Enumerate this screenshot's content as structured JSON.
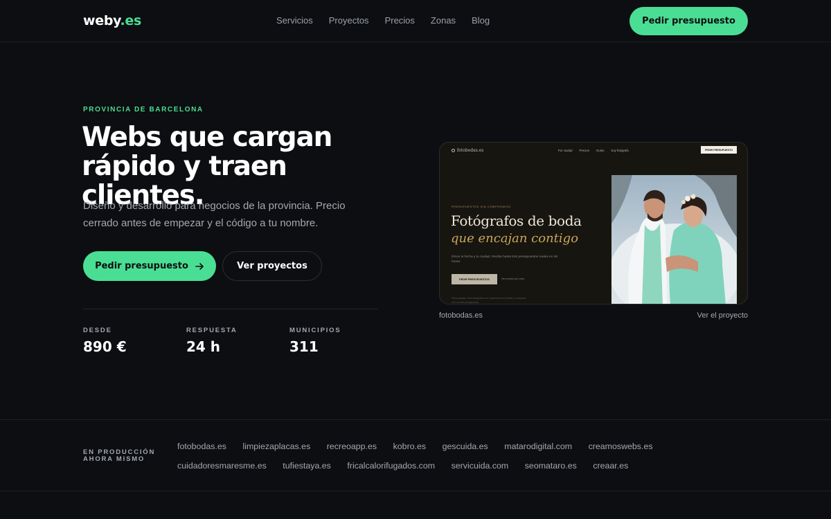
{
  "header": {
    "logo_name": "weby",
    "logo_tld": ".es",
    "nav": [
      "Servicios",
      "Proyectos",
      "Precios",
      "Zonas",
      "Blog"
    ],
    "cta_label": "Pedir presupuesto"
  },
  "hero": {
    "eyebrow": "PROVINCIA DE BARCELONA",
    "headline_line1": "Webs que cargan",
    "headline_line2": "rápido y traen clientes.",
    "lead_line1": "Diseño y desarrollo para negocios de la provincia. Precio",
    "lead_line2": "cerrado antes de empezar y el código a tu nombre.",
    "primary_button": "Pedir presupuesto",
    "secondary_button": "Ver proyectos",
    "stats": [
      {
        "label": "DESDE",
        "value": "890 €"
      },
      {
        "label": "RESPUESTA",
        "value": "24 h"
      },
      {
        "label": "MUNICIPIOS",
        "value": "311"
      }
    ]
  },
  "preview": {
    "site_logo": "fotobodas.es",
    "site_nav": [
      "Por ciudad",
      "Precios",
      "Guías",
      "Soy fotógrafo"
    ],
    "site_cta": "PEDIR PRESUPUESTO",
    "site_eyebrow": "PRESUPUESTOS SIN COMPROMISO",
    "site_title_line1": "Fotógrafos de boda",
    "site_title_line2": "que encajan contigo",
    "site_subtitle": "Dinos tu fecha y tu ciudad. Recibe hasta tres presupuestos reales en 48 horas.",
    "site_button": "PEDIR PRESUPUESTOS",
    "site_button_note": "Ver precios por zona",
    "site_footnote": "Para parejas. Solo fotógrafos con experiencia en bodas, y contacta con un solo presupuesto.",
    "caption": "fotobodas.es",
    "link": "Ver el proyecto"
  },
  "production": {
    "label_line1": "EN PRODUCCIÓN",
    "label_line2": "AHORA MISMO",
    "row1": [
      "fotobodas.es",
      "limpiezaplacas.es",
      "recreoapp.es",
      "kobro.es",
      "gescuida.es",
      "matarodigital.com",
      "creamoswebs.es"
    ],
    "row2": [
      "cuidadoresmaresme.es",
      "tufiestaya.es",
      "fricalcalorifugados.com",
      "servicuida.com",
      "seomataro.es",
      "creaar.es"
    ]
  },
  "colors": {
    "accent": "#4ade94",
    "background": "#0d0e11",
    "muted": "#a3a8b1"
  },
  "icons": {
    "primary_button_icon": "arrow-right-icon"
  }
}
